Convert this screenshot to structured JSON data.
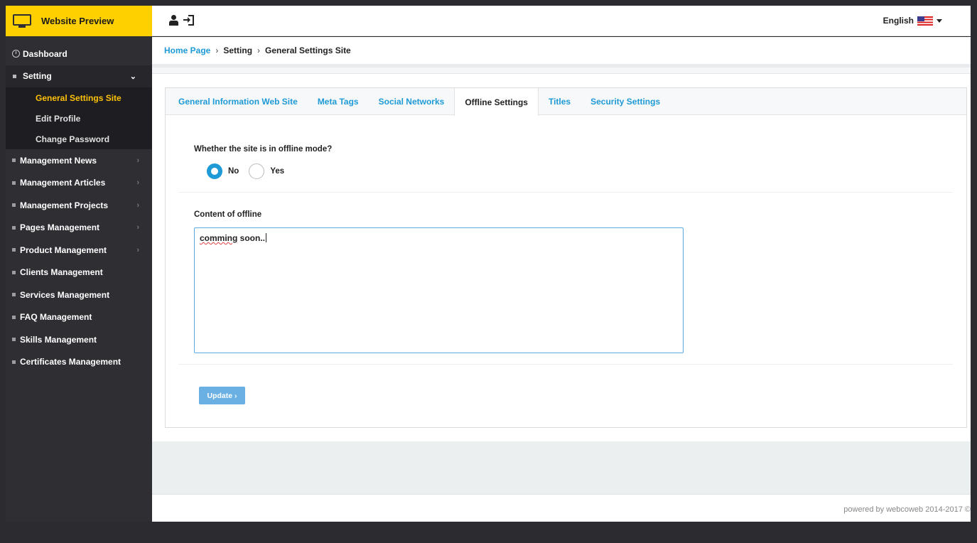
{
  "brand": {
    "title": "Website Preview"
  },
  "sidebar": {
    "dashboard": "Dashboard",
    "setting": "Setting",
    "setting_sub": [
      "General Settings Site",
      "Edit Profile",
      "Change Password"
    ],
    "items_with_chevron": [
      "Management News",
      "Management Articles",
      "Management Projects",
      "Pages Management",
      "Product Management"
    ],
    "items_plain": [
      "Clients Management",
      "Services Management",
      "FAQ Management",
      "Skills Management",
      "Certificates Management"
    ]
  },
  "topbar": {
    "language": "English"
  },
  "breadcrumb": {
    "home": "Home Page",
    "sep": "›",
    "level1": "Setting",
    "level2": "General Settings Site"
  },
  "tabs": [
    "General Information Web Site",
    "Meta Tags",
    "Social Networks",
    "Offline Settings",
    "Titles",
    "Security Settings"
  ],
  "active_tab_index": 3,
  "form": {
    "offline_question": "Whether the site is in offline mode?",
    "option_no": "No",
    "option_yes": "Yes",
    "selected": "No",
    "content_label": "Content of offline",
    "content_word1": "comming",
    "content_rest": " soon..",
    "update_label": "Update ›"
  },
  "footer": {
    "text": "powered by webcoweb 2014-2017 ©"
  },
  "colors": {
    "accent": "#1e9ad6",
    "brand": "#ffd000",
    "sidebar": "#2e2e33",
    "active_sub": "#ffc107"
  }
}
